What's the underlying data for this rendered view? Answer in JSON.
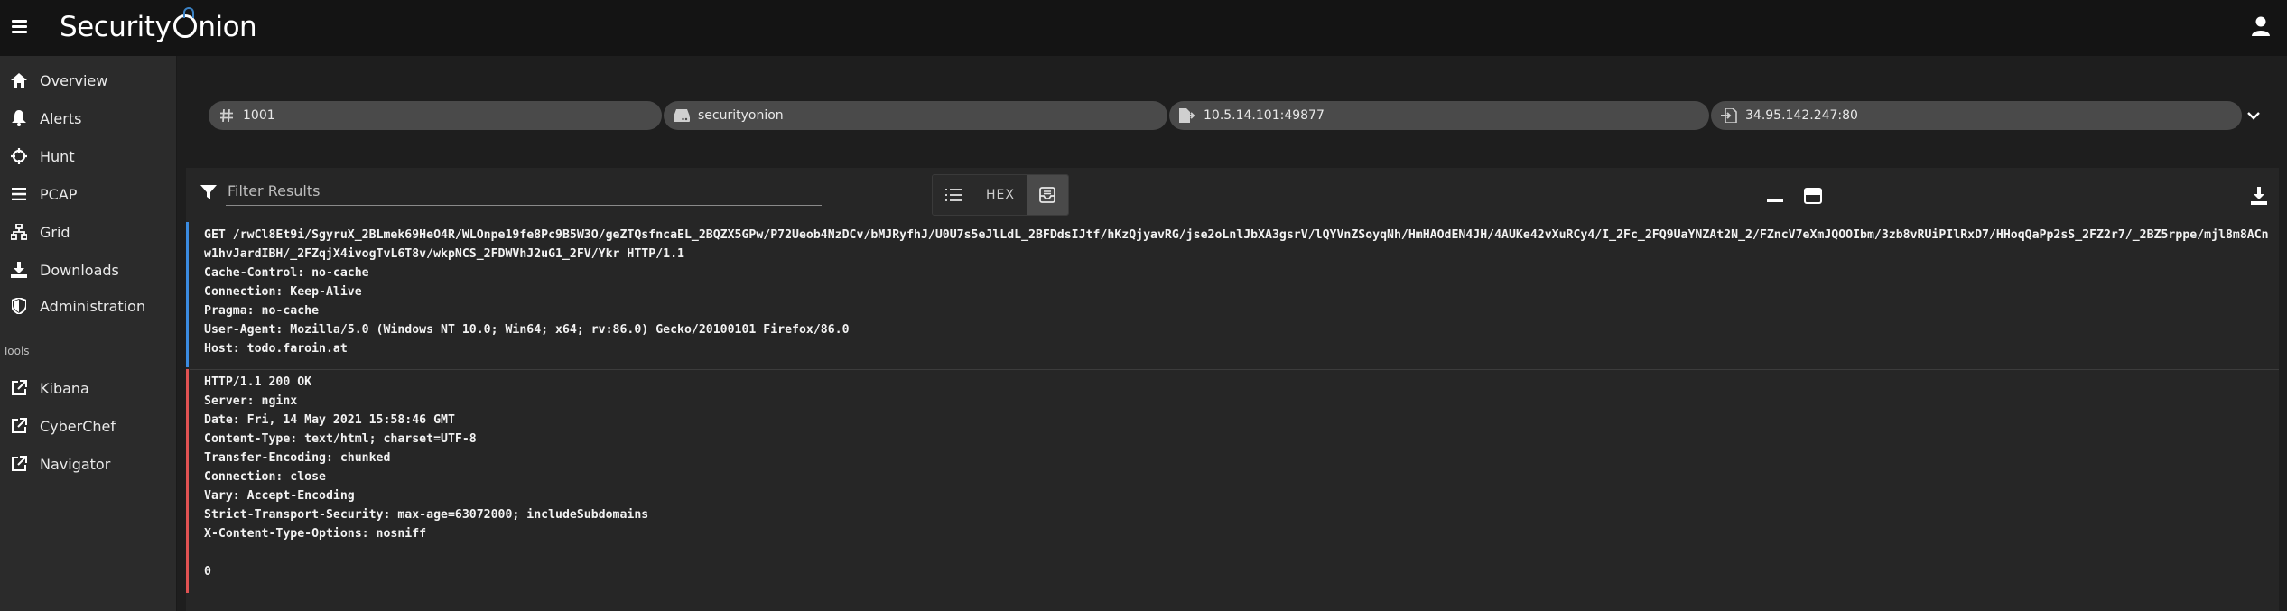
{
  "app": {
    "logo_left": "Security",
    "logo_right": "nion"
  },
  "sidebar": {
    "items": [
      {
        "label": "Overview",
        "icon": "home-icon"
      },
      {
        "label": "Alerts",
        "icon": "bell-icon"
      },
      {
        "label": "Hunt",
        "icon": "crosshairs-icon"
      },
      {
        "label": "PCAP",
        "icon": "list-icon"
      },
      {
        "label": "Grid",
        "icon": "sitemap-icon"
      },
      {
        "label": "Downloads",
        "icon": "download-icon"
      },
      {
        "label": "Administration",
        "icon": "shield-icon"
      }
    ],
    "tools_label": "Tools",
    "tools": [
      {
        "label": "Kibana",
        "icon": "external-link-icon"
      },
      {
        "label": "CyberChef",
        "icon": "external-link-icon"
      },
      {
        "label": "Navigator",
        "icon": "external-link-icon"
      }
    ]
  },
  "pcap": {
    "chips": [
      {
        "text": "1001",
        "icon": "hash-icon"
      },
      {
        "text": "securityonion",
        "icon": "server-icon"
      },
      {
        "text": "10.5.14.101:49877",
        "icon": "file-export-icon"
      },
      {
        "text": "34.95.142.247:80",
        "icon": "file-import-icon"
      }
    ],
    "filter_placeholder": "Filter Results",
    "view_hex_label": "HEX",
    "client_lines": [
      "GET /rwCl8Et9i/SgyruX_2BLmek69HeO4R/WLOnpe19fe8Pc9B5W3O/geZTQsfncaEL_2BQZX5GPw/P72Ueob4NzDCv/bMJRyfhJ/U0U7s5eJlLdL_2BFDdsIJtf/hKzQjyavRG/jse2oLnlJbXA3gsrV/lQYVnZSoyqNh/HmHAOdEN4JH/4AUKe42vXuRCy4/I_2Fc_2FQ9UaYNZAt2N_2/FZncV7eXmJQOOIbm/3zb8vRUiPIlRxD7/HHoqQaPp2sS_2FZ2r7/_2BZ5rppe/mjl8m8ACnw1hvJardIBH/_2FZqjX4ivogTvL6T8v/wkpNCS_2FDWVhJ2uG1_2FV/Ykr HTTP/1.1",
      "Cache-Control: no-cache",
      "Connection: Keep-Alive",
      "Pragma: no-cache",
      "User-Agent: Mozilla/5.0 (Windows NT 10.0; Win64; x64; rv:86.0) Gecko/20100101 Firefox/86.0",
      "Host: todo.faroin.at"
    ],
    "server_lines": [
      "HTTP/1.1 200 OK",
      "Server: nginx",
      "Date: Fri, 14 May 2021 15:58:46 GMT",
      "Content-Type: text/html; charset=UTF-8",
      "Transfer-Encoding: chunked",
      "Connection: close",
      "Vary: Accept-Encoding",
      "Strict-Transport-Security: max-age=63072000; includeSubdomains",
      "X-Content-Type-Options: nosniff",
      "",
      "0"
    ]
  },
  "colors": {
    "client_bar": "#3b8be0",
    "server_bar": "#e05252",
    "brand_accent": "#3b82c4"
  }
}
